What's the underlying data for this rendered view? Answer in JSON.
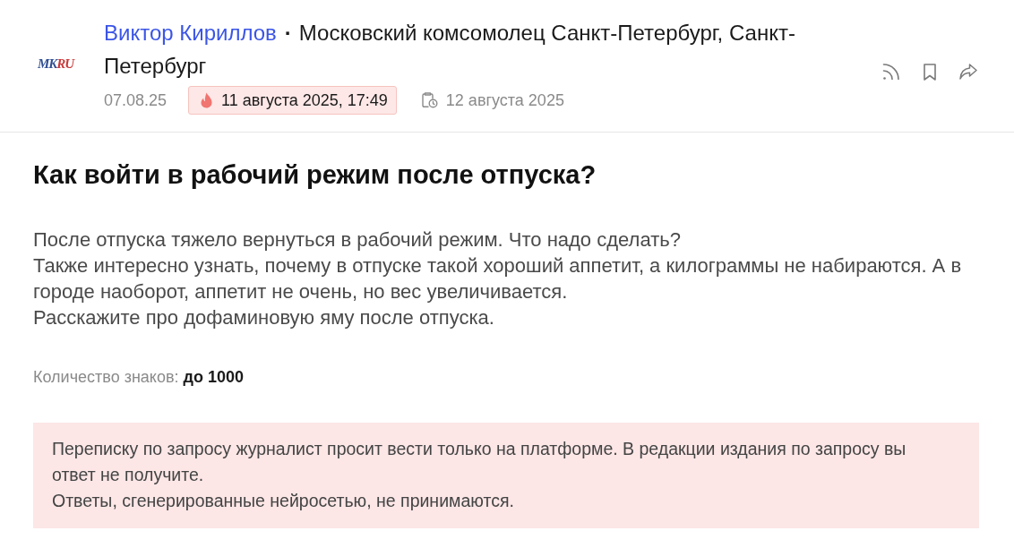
{
  "header": {
    "logo": [
      "MK",
      "RU"
    ],
    "author": "Виктор Кириллов",
    "separator": "·",
    "outlet": "Московский комсомолец Санкт-Петербург, Санкт-Петербург",
    "published": "07.08.25",
    "deadline": "11 августа 2025, 17:49",
    "updated": "12 августа 2025"
  },
  "question": {
    "title": "Как войти в рабочий режим после отпуска?",
    "body": [
      "После отпуска тяжело вернуться в рабочий режим. Что надо сделать?",
      "Также интересно узнать, почему в отпуске такой хороший аппетит, а килограммы не набираются. А в городе наоборот, аппетит не очень, но вес увеличивается.",
      "Расскажите про дофаминовую яму после отпуска."
    ],
    "char_limit": "Количество знаков: **до 1000**"
  },
  "notice": [
    "Переписку по запросу журналист просит вести только на платформе. В редакции издания по запросу вы ответ не получите.",
    "Ответы, сгенерированные нейросетью, не принимаются."
  ]
}
